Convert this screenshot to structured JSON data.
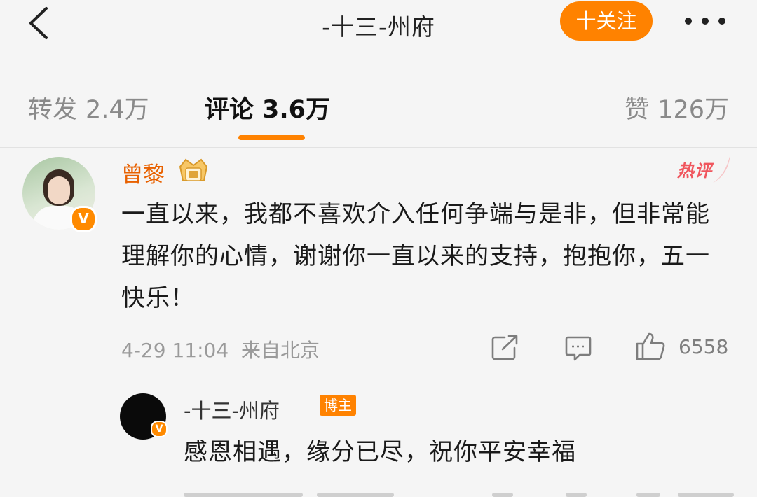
{
  "header": {
    "title": "-十三-州府",
    "follow_label": "十关注"
  },
  "tabs": {
    "forward_label": "转发",
    "forward_count": "2.4万",
    "comment_label": "评论",
    "comment_count": "3.6万",
    "like_label": "赞",
    "like_count": "126万"
  },
  "comment": {
    "username": "曾黎",
    "hot_badge": "热评",
    "verified_mark": "V",
    "text": "一直以来，我都不喜欢介入任何争端与是非，但非常能理解你的心情，谢谢你一直以来的支持，抱抱你，五一快乐！",
    "time": "4-29 11:04",
    "location": "来自北京",
    "likes": "6558"
  },
  "reply": {
    "username": "-十三-州府",
    "badge": "博主",
    "verified_mark": "V",
    "text": "感恩相遇，缘分已尽，祝你平安幸福"
  },
  "colors": {
    "accent": "#ff8200",
    "username": "#e86100",
    "hot": "#f0565e",
    "muted": "#9a9a9a"
  }
}
